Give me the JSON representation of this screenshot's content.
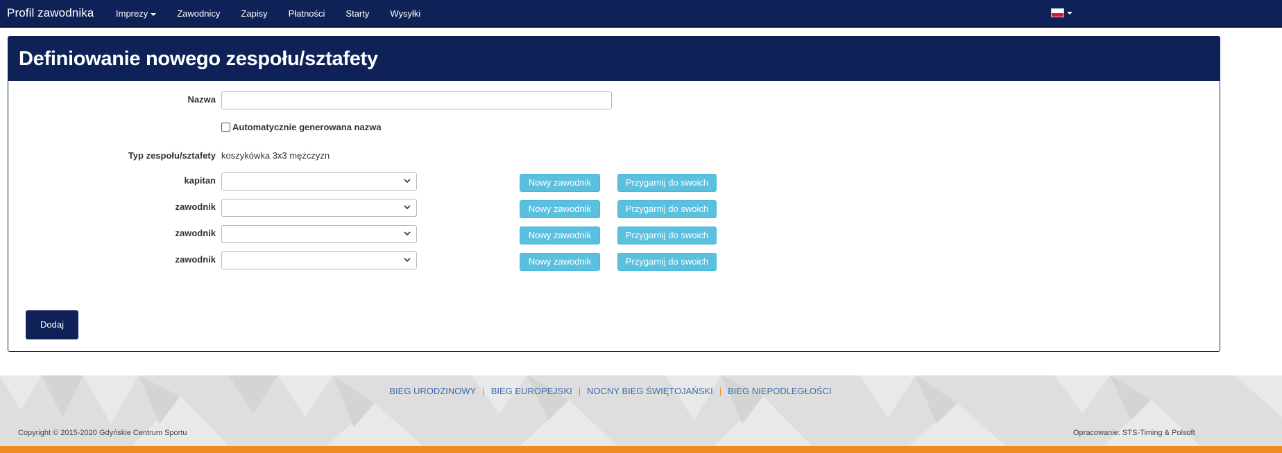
{
  "navbar": {
    "brand": "Profil zawodnika",
    "items": [
      {
        "label": "Imprezy",
        "dropdown": true
      },
      {
        "label": "Zawodnicy"
      },
      {
        "label": "Zapisy"
      },
      {
        "label": "Płatności"
      },
      {
        "label": "Starty"
      },
      {
        "label": "Wysyłki"
      }
    ],
    "language_icon": "poland-flag-icon"
  },
  "panel": {
    "title": "Definiowanie nowego zespołu/sztafety",
    "name_label": "Nazwa",
    "name_value": "",
    "auto_name_label": "Automatycznie generowana nazwa",
    "auto_name_checked": false,
    "type_label": "Typ zespołu/sztafety",
    "type_value": "koszykówka 3x3 mężczyzn",
    "members": [
      {
        "label": "kapitan",
        "value": "",
        "new_button": "Nowy zawodnik",
        "adopt_button": "Przygarnij do swoich"
      },
      {
        "label": "zawodnik",
        "value": "",
        "new_button": "Nowy zawodnik",
        "adopt_button": "Przygarnij do swoich"
      },
      {
        "label": "zawodnik",
        "value": "",
        "new_button": "Nowy zawodnik",
        "adopt_button": "Przygarnij do swoich"
      },
      {
        "label": "zawodnik",
        "value": "",
        "new_button": "Nowy zawodnik",
        "adopt_button": "Przygarnij do swoich"
      }
    ],
    "submit_label": "Dodaj"
  },
  "footer": {
    "links": [
      "BIEG URODZINOWY",
      "BIEG EUROPEJSKI",
      "NOCNY BIEG ŚWIĘTOJAŃSKI",
      "BIEG NIEPODLEGŁOŚCI"
    ],
    "copyright": "Copyright © 2015-2020 Gdyńskie Centrum Sportu",
    "credits": "Opracowanie: STS-Timing & Polsoft"
  },
  "colors": {
    "navy": "#0f2257",
    "info_button": "#5bc0de",
    "accent_orange": "#f28a24",
    "footer_link": "#3a6aa8"
  }
}
